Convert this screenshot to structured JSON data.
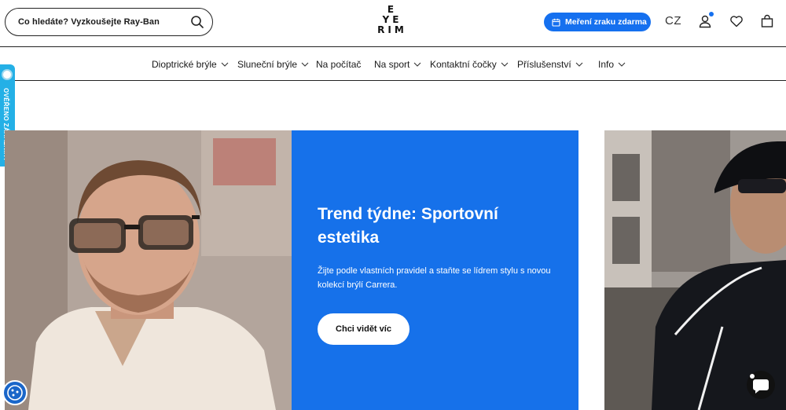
{
  "header": {
    "search_placeholder": "Co hledáte? Vyzkoušejte Ray-Ban",
    "logo_lines": [
      "E",
      "YE",
      "RIM"
    ],
    "measure_button": "Meření zraku zdarma",
    "language": "CZ"
  },
  "nav": {
    "items": [
      {
        "label": "Dioptrické brýle",
        "dropdown": true
      },
      {
        "label": "Sluneční brýle",
        "dropdown": true
      },
      {
        "label": "Na počítač",
        "dropdown": false
      },
      {
        "label": "Na sport",
        "dropdown": true
      },
      {
        "label": "Kontaktní čočky",
        "dropdown": true
      },
      {
        "label": "Příslušenství",
        "dropdown": true
      },
      {
        "label": "Info",
        "dropdown": true
      }
    ]
  },
  "side_tab": {
    "label": "OVĚŘENO ZÁKAZNÍKY"
  },
  "hero": {
    "title": "Trend týdne: Sportovní estetika",
    "description": "Žijte podle vlastních pravidel a staňte se lídrem stylu s novou kolekcí brýlí Carrera.",
    "button": "Chci vidět víc"
  },
  "colors": {
    "accent": "#1570ef",
    "hero_panel": "#1671ea",
    "side_tab": "#24b0e6"
  },
  "icons": {
    "search": "search-icon",
    "calendar": "calendar-icon",
    "user": "user-icon",
    "wishlist": "heart-icon",
    "cart": "bag-icon",
    "cookies": "cookie-icon",
    "chat": "chat-icon"
  }
}
